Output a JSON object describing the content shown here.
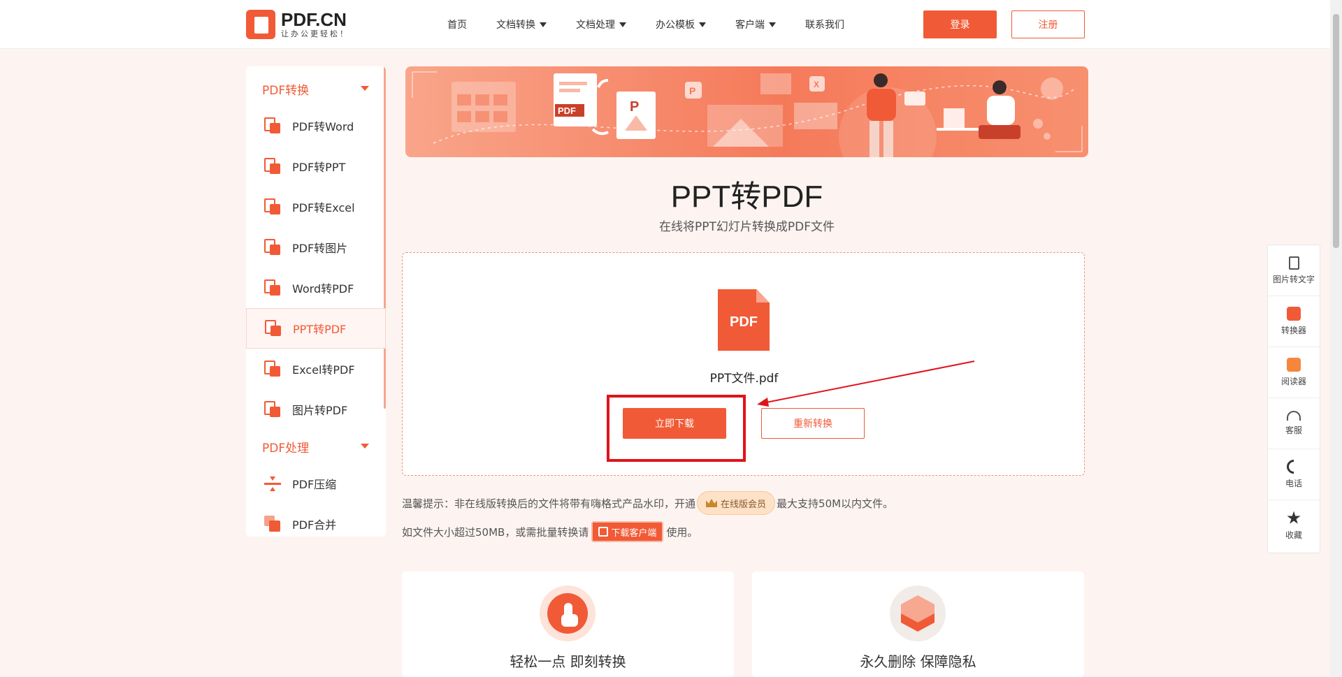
{
  "header": {
    "logo_name": "PDF.CN",
    "logo_slogan": "让办公更轻松！",
    "nav": [
      "首页",
      "文档转换",
      "文档处理",
      "办公模板",
      "客户端",
      "联系我们"
    ],
    "login_label": "登录",
    "register_label": "注册"
  },
  "sidebar": {
    "group1": "PDF转换",
    "items": [
      "PDF转Word",
      "PDF转PPT",
      "PDF转Excel",
      "PDF转图片",
      "Word转PDF",
      "PPT转PDF",
      "Excel转PDF",
      "图片转PDF"
    ],
    "active_index": 5,
    "group2": "PDF处理",
    "items2": [
      "PDF压缩",
      "PDF合并"
    ]
  },
  "banner": {
    "badge_pdf": "PDF",
    "badge_p": "P",
    "badge_p2": "P",
    "badge_x": "X"
  },
  "main": {
    "title": "PPT转PDF",
    "subtitle": "在线将PPT幻灯片转换成PDF文件",
    "file_icon_label": "PDF",
    "file_name": "PPT文件.pdf",
    "download_label": "立即下载",
    "reconvert_label": "重新转换"
  },
  "tips": {
    "tip1_prefix": "温馨提示：非在线版转换后的文件将带有嗨格式产品水印，开通",
    "vip_label": "在线版会员",
    "tip1_suffix": "最大支持50M以内文件。",
    "tip2_prefix": "如文件大小超过50MB，或需批量转换请",
    "client_label": "下载客户端",
    "tip2_suffix": "使用。"
  },
  "features": [
    {
      "title": "轻松一点 即刻转换"
    },
    {
      "title": "永久删除 保障隐私"
    }
  ],
  "float_panel": [
    "图片转文字",
    "转换器",
    "阅读器",
    "客服",
    "电话",
    "收藏"
  ],
  "colors": {
    "accent": "#f15a36",
    "highlight": "#e0131b",
    "background": "#fdf4f1"
  }
}
